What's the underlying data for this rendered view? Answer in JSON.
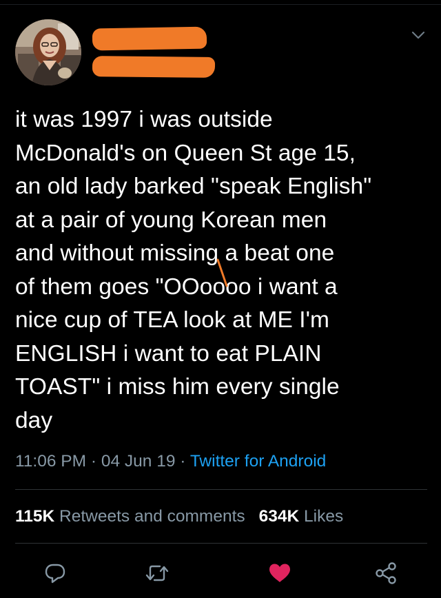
{
  "user": {
    "avatar_icon": "profile-photo-avatar",
    "display_name_redacted": true,
    "handle_redacted": true,
    "redaction_color": "#f07a28"
  },
  "tweet": {
    "lines": [
      "it was 1997 i was outside",
      "McDonald's on Queen St age 15,",
      "an old lady barked \"speak English\"",
      "at a pair of young Korean men",
      "and without missing a beat one",
      "of them goes \"OOoooo i want a",
      "nice cup of TEA look at ME I'm",
      "ENGLISH i want to eat PLAIN",
      "TOAST\" i miss him every single",
      "day"
    ]
  },
  "meta": {
    "time": "11:06 PM",
    "date": "04 Jun 19",
    "separator": " · ",
    "source": "Twitter for Android"
  },
  "stats": {
    "retweets_count": "115K",
    "retweets_label": "Retweets and comments",
    "likes_count": "634K",
    "likes_label": "Likes"
  },
  "actions": {
    "reply_icon": "reply-icon",
    "retweet_icon": "retweet-icon",
    "like_icon": "heart-icon",
    "share_icon": "share-icon",
    "liked": true
  },
  "colors": {
    "background": "#000000",
    "text": "#ffffff",
    "secondary": "#8899a6",
    "link": "#1da1f2",
    "like": "#e0245e",
    "divider": "#2f3336"
  }
}
